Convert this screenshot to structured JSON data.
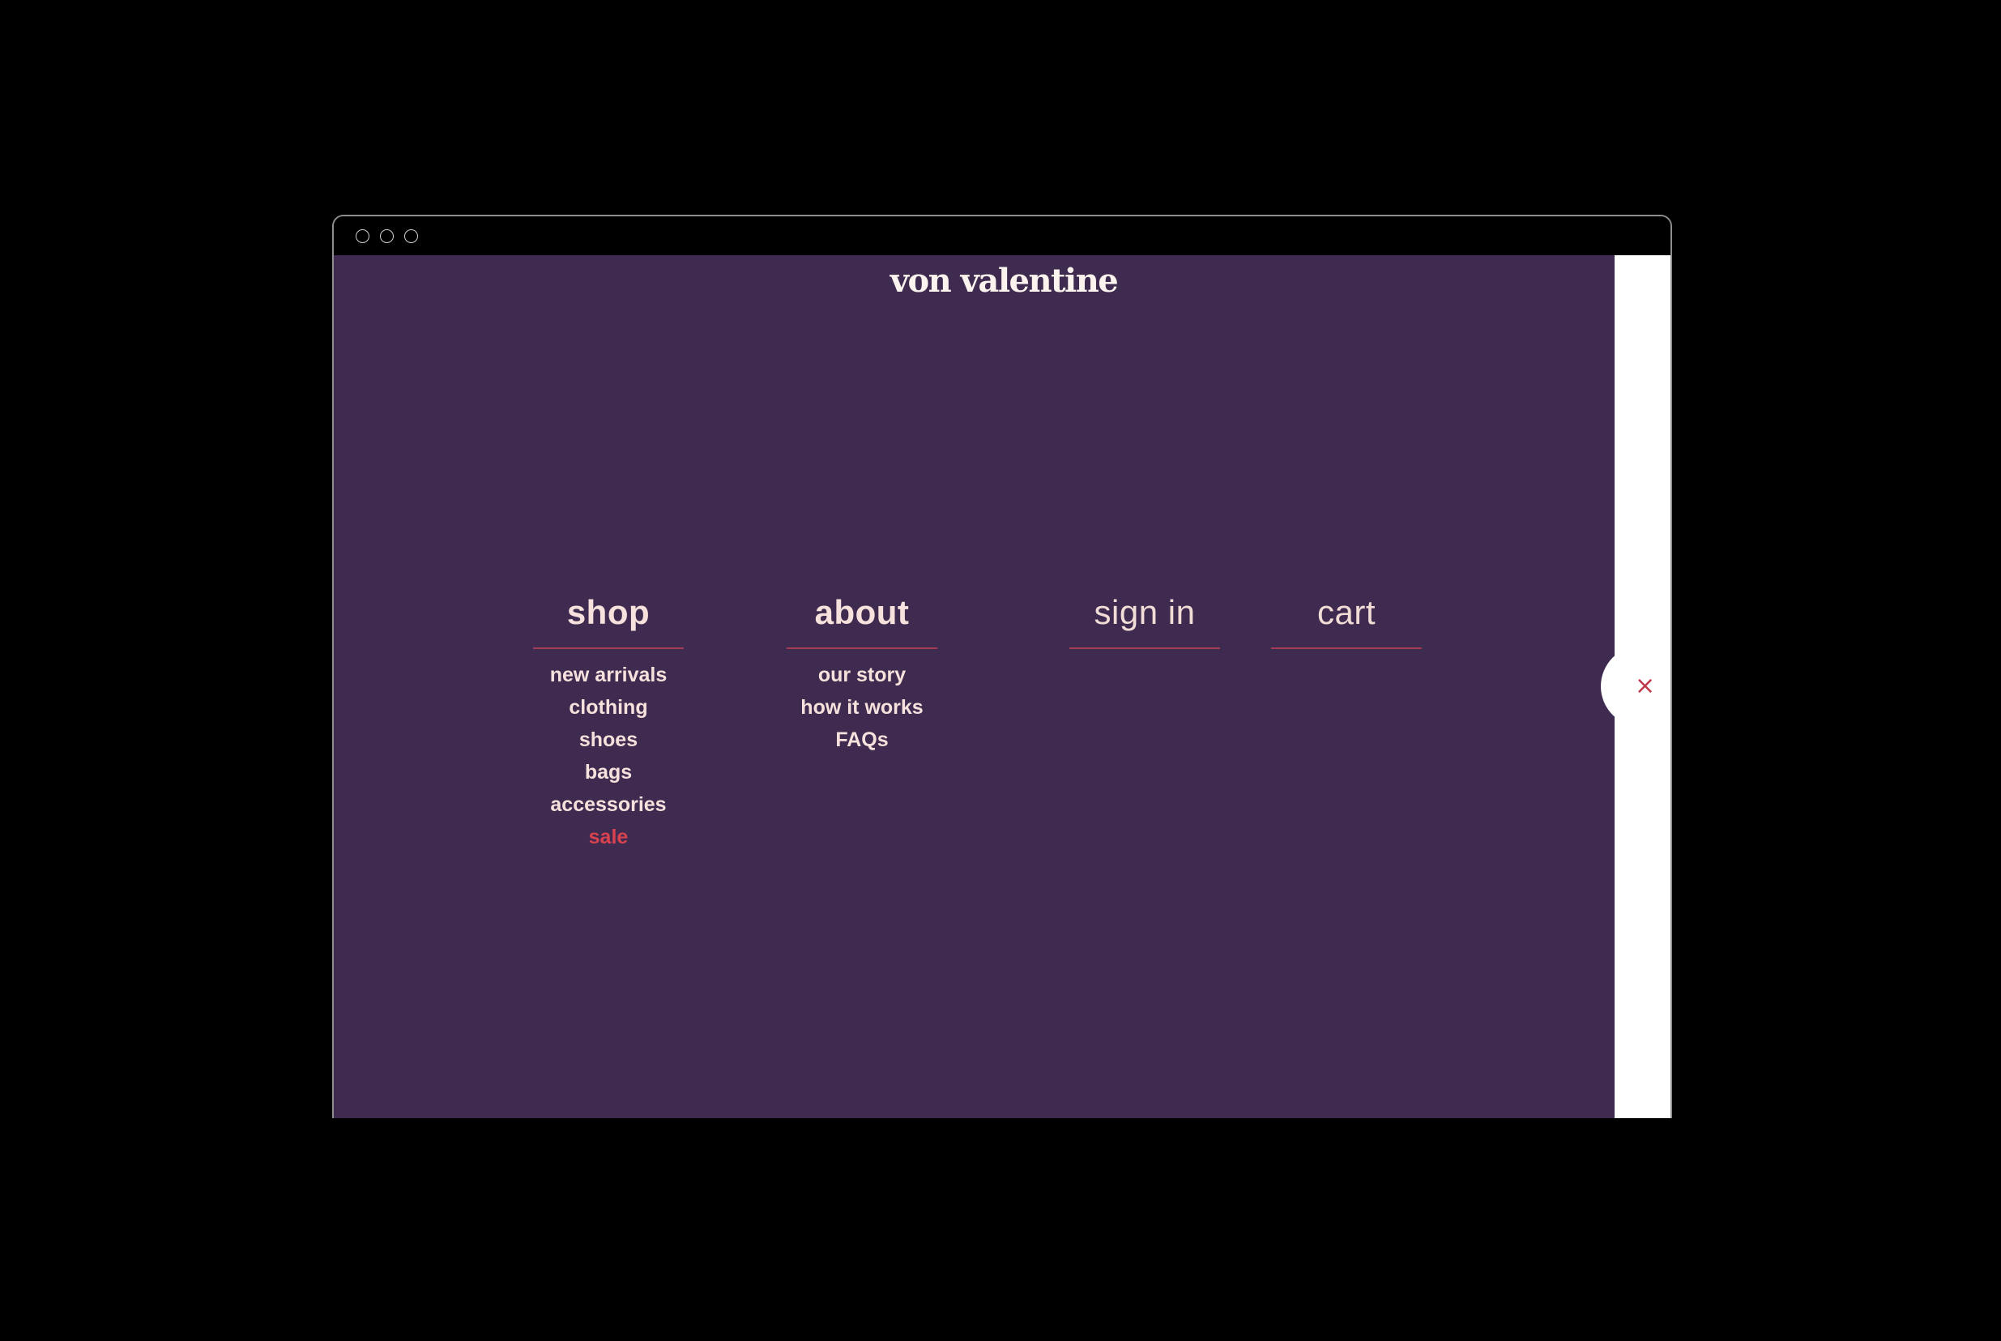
{
  "window": {
    "controls": [
      "close",
      "minimize",
      "maximize"
    ]
  },
  "site": {
    "logo": "von valentine"
  },
  "menu": {
    "columns": [
      {
        "heading": "shop",
        "items": [
          {
            "label": "new arrivals"
          },
          {
            "label": "clothing"
          },
          {
            "label": "shoes"
          },
          {
            "label": "bags"
          },
          {
            "label": "accessories"
          },
          {
            "label": "sale",
            "highlight": true
          }
        ]
      },
      {
        "heading": "about",
        "items": [
          {
            "label": "our story"
          },
          {
            "label": "how it works"
          },
          {
            "label": "FAQs"
          }
        ]
      },
      {
        "heading": "sign in",
        "items": []
      },
      {
        "heading": "cart",
        "items": []
      }
    ],
    "close_icon": "close-icon",
    "close_glyph": "×"
  },
  "colors": {
    "panel_background": "#3f2b4f",
    "text": "#f7e1dc",
    "divider": "#a13b58",
    "sale_accent": "#d8434f",
    "close_icon": "#c0394b",
    "side_area": "#ffffff"
  }
}
